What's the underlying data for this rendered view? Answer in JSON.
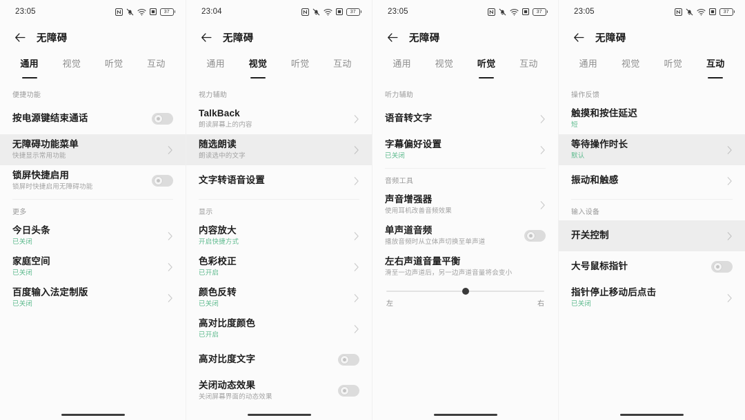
{
  "app": {
    "title": "无障碍"
  },
  "tab_labels": [
    "通用",
    "视觉",
    "听觉",
    "互动"
  ],
  "icons": {
    "back": "back-arrow-icon",
    "chevron": "chevron-right-icon",
    "nfc": "nfc-icon",
    "mute": "mute-bell-icon",
    "wifi": "wifi-icon",
    "sd": "sd-card-icon",
    "battery": "battery-icon"
  },
  "screens": [
    {
      "id": "general",
      "status": {
        "time": "23:05",
        "battery": "37"
      },
      "active_tab": 0,
      "sections": [
        {
          "label": "便捷功能",
          "rows": [
            {
              "title": "按电源键结束通话",
              "sub": "",
              "sub_green": false,
              "control": "toggle",
              "toggle_on": false,
              "highlight": false
            },
            {
              "title": "无障碍功能菜单",
              "sub": "快捷显示常用功能",
              "sub_green": false,
              "control": "chevron",
              "highlight": true
            },
            {
              "title": "锁屏快捷启用",
              "sub": "锁屏时快捷启用无障碍功能",
              "sub_green": false,
              "control": "toggle",
              "toggle_on": false,
              "highlight": false
            }
          ]
        },
        {
          "label": "更多",
          "rows": [
            {
              "title": "今日头条",
              "sub": "已关闭",
              "sub_green": true,
              "control": "chevron",
              "highlight": false
            },
            {
              "title": "家庭空间",
              "sub": "已关闭",
              "sub_green": true,
              "control": "chevron",
              "highlight": false
            },
            {
              "title": "百度输入法定制版",
              "sub": "已关闭",
              "sub_green": true,
              "control": "chevron",
              "highlight": false
            }
          ]
        }
      ]
    },
    {
      "id": "vision",
      "status": {
        "time": "23:04",
        "battery": "37"
      },
      "active_tab": 1,
      "sections": [
        {
          "label": "视力辅助",
          "rows": [
            {
              "title": "TalkBack",
              "sub": "朗读屏幕上的内容",
              "sub_green": false,
              "control": "chevron",
              "highlight": false
            },
            {
              "title": "随选朗读",
              "sub": "朗读选中的文字",
              "sub_green": false,
              "control": "chevron",
              "highlight": true
            },
            {
              "title": "文字转语音设置",
              "sub": "",
              "sub_green": false,
              "control": "chevron",
              "highlight": false
            }
          ]
        },
        {
          "label": "显示",
          "rows": [
            {
              "title": "内容放大",
              "sub": "开启快捷方式",
              "sub_green": true,
              "control": "chevron",
              "highlight": false
            },
            {
              "title": "色彩校正",
              "sub": "已开启",
              "sub_green": true,
              "control": "chevron",
              "highlight": false
            },
            {
              "title": "颜色反转",
              "sub": "已关闭",
              "sub_green": true,
              "control": "chevron",
              "highlight": false
            },
            {
              "title": "高对比度颜色",
              "sub": "已开启",
              "sub_green": true,
              "control": "chevron",
              "highlight": false
            },
            {
              "title": "高对比度文字",
              "sub": "",
              "sub_green": false,
              "control": "toggle",
              "toggle_on": false,
              "highlight": false
            },
            {
              "title": "关闭动态效果",
              "sub": "关闭屏幕界面的动态效果",
              "sub_green": false,
              "control": "toggle",
              "toggle_on": false,
              "highlight": false
            }
          ]
        }
      ]
    },
    {
      "id": "hearing",
      "status": {
        "time": "23:05",
        "battery": "37"
      },
      "active_tab": 2,
      "sections": [
        {
          "label": "听力辅助",
          "rows": [
            {
              "title": "语音转文字",
              "sub": "",
              "sub_green": false,
              "control": "chevron",
              "highlight": false
            },
            {
              "title": "字幕偏好设置",
              "sub": "已关闭",
              "sub_green": true,
              "control": "chevron",
              "highlight": false
            }
          ]
        },
        {
          "label": "音频工具",
          "rows": [
            {
              "title": "声音增强器",
              "sub": "使用耳机改善音频效果",
              "sub_green": false,
              "control": "chevron",
              "highlight": false
            },
            {
              "title": "单声道音频",
              "sub": "播放音频时从立体声切换至单声道",
              "sub_green": false,
              "control": "toggle",
              "toggle_on": false,
              "highlight": false
            },
            {
              "title": "左右声道音量平衡",
              "sub": "滑至一边声道后，另一边声道音量将会变小",
              "sub_green": false,
              "control": "none",
              "highlight": false
            }
          ],
          "slider": {
            "value": 50,
            "left_label": "左",
            "right_label": "右"
          }
        }
      ]
    },
    {
      "id": "interaction",
      "status": {
        "time": "23:05",
        "battery": "37"
      },
      "active_tab": 3,
      "sections": [
        {
          "label": "操作反馈",
          "rows": [
            {
              "title": "触摸和按住延迟",
              "sub": "短",
              "sub_green": true,
              "control": "none",
              "highlight": false
            },
            {
              "title": "等待操作时长",
              "sub": "默认",
              "sub_green": true,
              "control": "chevron",
              "highlight": true
            },
            {
              "title": "振动和触感",
              "sub": "",
              "sub_green": false,
              "control": "chevron",
              "highlight": false
            }
          ]
        },
        {
          "label": "输入设备",
          "rows": [
            {
              "title": "开关控制",
              "sub": "",
              "sub_green": false,
              "control": "chevron",
              "highlight": true
            },
            {
              "title": "大号鼠标指针",
              "sub": "",
              "sub_green": false,
              "control": "toggle",
              "toggle_on": false,
              "highlight": false
            },
            {
              "title": "指针停止移动后点击",
              "sub": "已关闭",
              "sub_green": true,
              "control": "chevron",
              "highlight": false
            }
          ]
        }
      ]
    }
  ],
  "colors": {
    "accent_green": "#5fbb8f",
    "text_primary": "#1d1d1d",
    "text_secondary": "#a2a2a2",
    "highlight_row": "#ededed"
  }
}
